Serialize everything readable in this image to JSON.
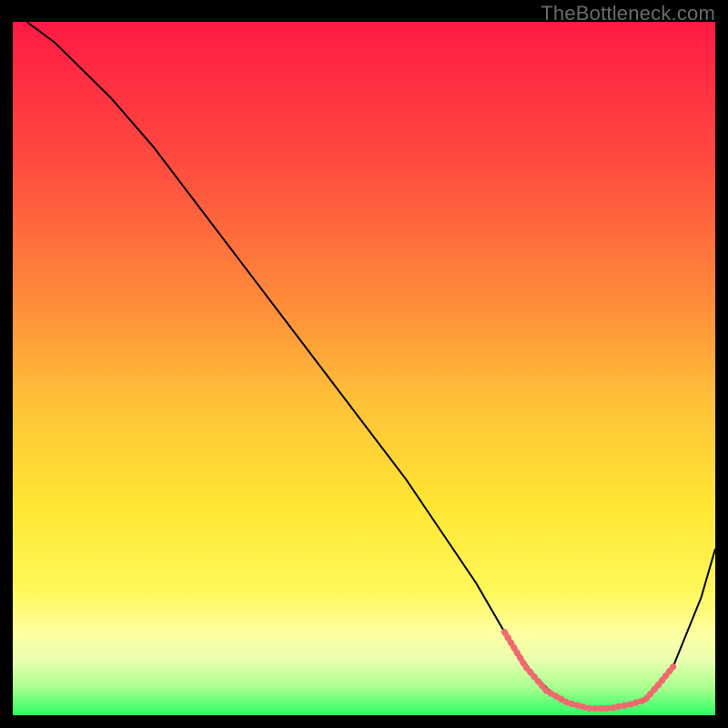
{
  "watermark": "TheBottleneck.com",
  "chart_data": {
    "type": "line",
    "title": "",
    "xlabel": "",
    "ylabel": "",
    "xlim": [
      0,
      100
    ],
    "ylim": [
      0,
      100
    ],
    "gradient": {
      "stops": [
        {
          "offset": 0.0,
          "color": "#ff1a44"
        },
        {
          "offset": 0.2,
          "color": "#ff4a3f"
        },
        {
          "offset": 0.4,
          "color": "#ff8a3a"
        },
        {
          "offset": 0.55,
          "color": "#ffc238"
        },
        {
          "offset": 0.7,
          "color": "#ffe733"
        },
        {
          "offset": 0.82,
          "color": "#fff85a"
        },
        {
          "offset": 0.88,
          "color": "#ffffa0"
        },
        {
          "offset": 0.92,
          "color": "#eaffb0"
        },
        {
          "offset": 0.96,
          "color": "#a8ff8e"
        },
        {
          "offset": 1.0,
          "color": "#2cff64"
        }
      ]
    },
    "series": [
      {
        "name": "bottleneck-curve",
        "color": "#000000",
        "width": 2,
        "x": [
          2,
          6,
          10,
          14,
          20,
          26,
          32,
          38,
          44,
          50,
          56,
          62,
          66,
          70,
          74,
          78,
          82,
          86,
          90,
          94,
          98,
          100
        ],
        "y": [
          100,
          97,
          93,
          89,
          82,
          74,
          66,
          58,
          50,
          42,
          34,
          25,
          19,
          12,
          6,
          2,
          1,
          1,
          2,
          7,
          17,
          24
        ]
      },
      {
        "name": "optimal-range",
        "color": "#ef6a6f",
        "width": 7,
        "dash": "1.5 5",
        "linecap": "round",
        "x": [
          70,
          73,
          76,
          79,
          82,
          85,
          88,
          90,
          92,
          94
        ],
        "y": [
          12,
          7,
          3.5,
          1.8,
          1,
          1,
          1.6,
          2.2,
          4.5,
          7
        ]
      }
    ]
  }
}
